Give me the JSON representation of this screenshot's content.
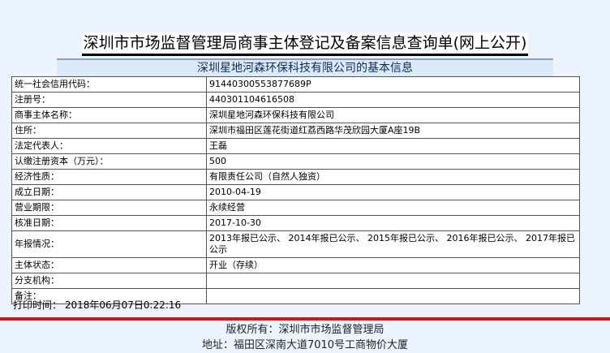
{
  "title": "深圳市市场监督管理局商事主体登记及备案信息查询单(网上公开)",
  "subtitle": "深圳星地河森环保科技有限公司的基本信息",
  "rows": [
    {
      "label": "统一社会信用代码：",
      "value": "91440300553877689P"
    },
    {
      "label": "注册号：",
      "value": "440301104616508"
    },
    {
      "label": "商事主体名称：",
      "value": "深圳星地河森环保科技有限公司"
    },
    {
      "label": "住所：",
      "value": "深圳市福田区莲花街道红荔西路华茂欣园大厦A座19B"
    },
    {
      "label": "法定代表人：",
      "value": "王磊"
    },
    {
      "label": "认缴注册资本（万元）：",
      "value": "500"
    },
    {
      "label": "经济性质：",
      "value": "有限责任公司（自然人独资）"
    },
    {
      "label": "成立日期：",
      "value": "2010-04-19"
    },
    {
      "label": "营业期限：",
      "value": "永续经营"
    },
    {
      "label": "核准日期：",
      "value": "2017-10-30"
    },
    {
      "label": "年报情况：",
      "value": "2013年报已公示、 2014年报已公示、 2015年报已公示、 2016年报已公示、 2017年报已公示"
    },
    {
      "label": "主体状态：",
      "value": "开业（存续）"
    },
    {
      "label": "分支机构：",
      "value": ""
    },
    {
      "label": "备注：",
      "value": ""
    }
  ],
  "print_time": "打印时间： 2018年06月07日0:22:16",
  "footer": {
    "copyright": "版权所有：深圳市市场监督管理局",
    "address": "地址：福田区深南大道7010号工商物价大厦"
  },
  "colors": {
    "background": "#ecf5ff",
    "divider": "#e01010"
  }
}
